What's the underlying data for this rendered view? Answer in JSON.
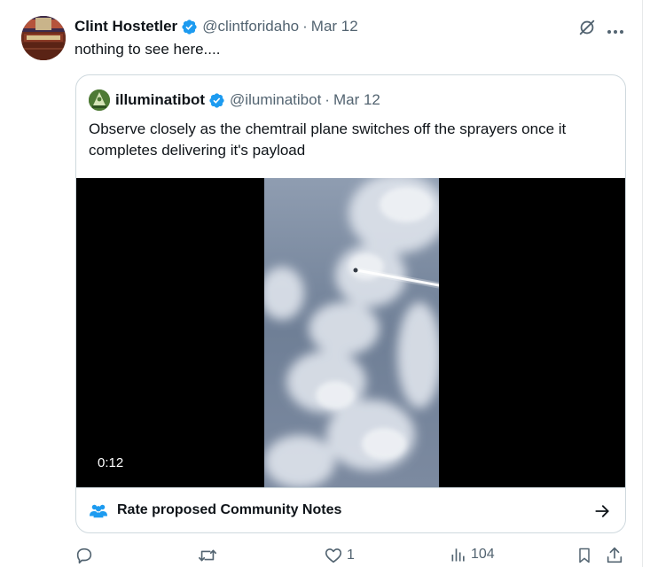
{
  "tweet": {
    "author_name": "Clint Hostetler",
    "handle": "@clintforidaho",
    "separator": "·",
    "date": "Mar 12",
    "text": "nothing to see here...."
  },
  "quote": {
    "author_name": "illuminatibot",
    "handle": "@iluminatibot",
    "separator": "·",
    "date": "Mar 12",
    "text": "Observe closely as the chemtrail plane switches off the sprayers once it completes delivering it's payload",
    "video_duration": "0:12",
    "community_notes_label": "Rate proposed Community Notes"
  },
  "actions": {
    "replies": "",
    "reposts": "",
    "likes": "1",
    "views": "104"
  },
  "colors": {
    "text": "#0f1419",
    "secondary": "#536471",
    "verified": "#1d9bf0",
    "border": "#cfd9de",
    "notes_icon": "#1d9bf0"
  }
}
